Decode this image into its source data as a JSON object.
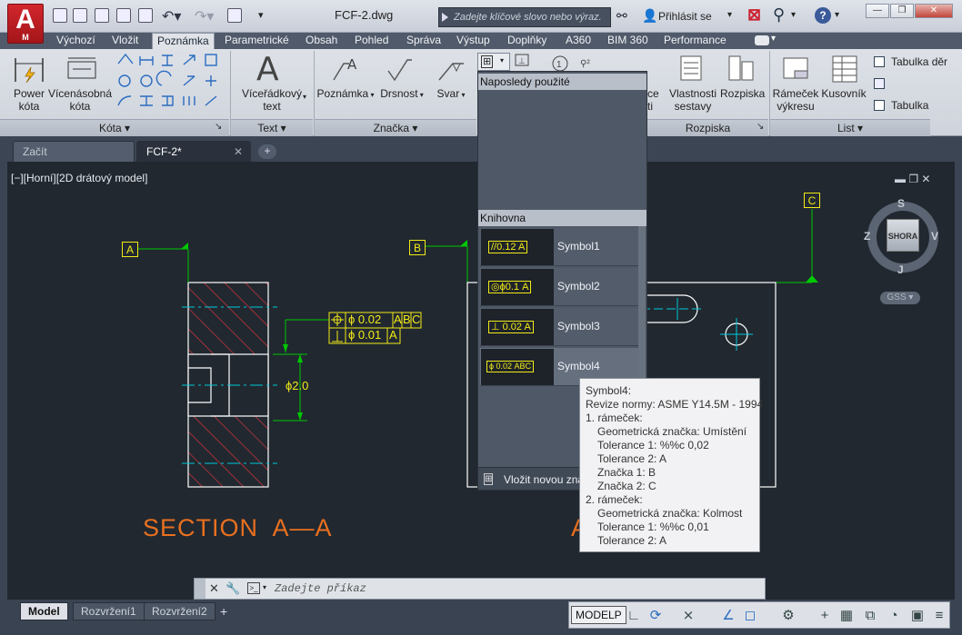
{
  "app": {
    "logo_letter": "A",
    "logo_sub": "M",
    "doc_title": "FCF-2.dwg"
  },
  "search": {
    "placeholder": "Zadejte klíčové slovo nebo výraz."
  },
  "signin": {
    "label": "Přihlásit se"
  },
  "window": {
    "minimize": "—",
    "restore": "❐",
    "close": "✕"
  },
  "ribbon_tabs": [
    "Výchozí",
    "Vložit",
    "Poznámka",
    "Parametrické",
    "Obsah",
    "Pohled",
    "Správa",
    "Výstup",
    "Doplňky",
    "A360",
    "BIM 360",
    "Performance"
  ],
  "active_tab": "Poznámka",
  "ribbon": {
    "kota": {
      "power": "Power\nkóta",
      "multi": "Vícenásobná\nkóta",
      "panel": "Kóta ▾"
    },
    "text": {
      "mtext": "Víceřádkový\ntext",
      "panel": "Text ▾",
      "icon_letter": "A"
    },
    "znacka": {
      "poznamka": "Poznámka",
      "drsnost": "Drsnost",
      "svar": "Svar",
      "panel": "Značka ▾"
    },
    "rozpiska": {
      "vlastnosti": "Vlastnosti\nsestavy",
      "rozpiska": "Rozpiska",
      "panel": "Rozpiska",
      "partial": "ce\nti"
    },
    "list": {
      "ramecek": "Rámeček\nvýkresu",
      "kusovnik": "Kusovník",
      "tab_der": "Tabulka děr",
      "tabulka": "Tabulka",
      "panel": "List ▾"
    }
  },
  "doc_tabs": [
    "Začít",
    "FCF-2*"
  ],
  "viewport_label": "[−][Horní][2D drátový model]",
  "drawing": {
    "datum_a": "A",
    "datum_b": "B",
    "datum_c": "C",
    "fcf1_tol": "ϕ 0.02",
    "fcf1_refs": [
      "A",
      "B",
      "C"
    ],
    "fcf2_tol": "ϕ 0.01",
    "fcf2_ref": "A",
    "diameter": "ϕ2.0",
    "section_title": "SECTION  A—A",
    "section_title_partial": "A"
  },
  "viewcube": {
    "top": "SHORA",
    "n": "S",
    "w": "Z",
    "e": "V",
    "s": "J",
    "gss": "GSS"
  },
  "dropdown": {
    "recent_header": "Naposledy použité",
    "library_header": "Knihovna",
    "items": [
      {
        "name": "Symbol1",
        "thumb": "//0.12 A"
      },
      {
        "name": "Symbol2",
        "thumb": "◎ϕ0.1 A"
      },
      {
        "name": "Symbol3",
        "thumb": "⊥ 0.02 A"
      },
      {
        "name": "Symbol4",
        "thumb": "ϕ 0.02 ABC"
      }
    ],
    "insert_new": "Vložit novou zna"
  },
  "tooltip": {
    "lines": [
      "Symbol4:",
      "Revize normy: ASME Y14.5M - 1994",
      "1. rámeček:",
      "Geometrická značka: Umístění",
      "Tolerance 1: %%c 0,02",
      "Tolerance 2: A",
      "Značka 1: B",
      "Značka 2: C",
      "2. rámeček:",
      "Geometrická značka: Kolmost",
      "Tolerance 1: %%c 0,01",
      "Tolerance 2: A"
    ]
  },
  "command": {
    "placeholder": "Zadejte příkaz"
  },
  "layout_tabs": [
    "Model",
    "Rozvržení1",
    "Rozvržení2"
  ],
  "status": {
    "model_space": "MODELP"
  }
}
